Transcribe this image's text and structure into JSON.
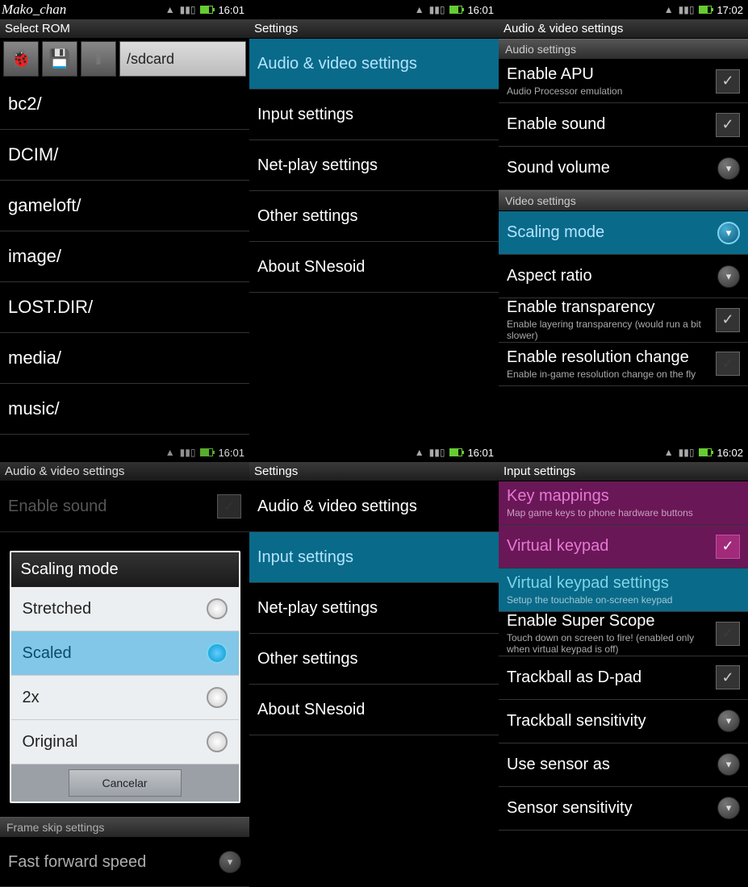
{
  "watermark": "Mako_chan",
  "panels": {
    "p1": {
      "time": "16:01",
      "title": "Select ROM",
      "path": "/sdcard",
      "items": [
        "bc2/",
        "DCIM/",
        "gameloft/",
        "image/",
        "LOST.DIR/",
        "media/",
        "music/"
      ]
    },
    "p2": {
      "time": "16:01",
      "title": "Settings",
      "items": [
        {
          "label": "Audio & video settings",
          "sel": true
        },
        {
          "label": "Input settings"
        },
        {
          "label": "Net-play settings"
        },
        {
          "label": "Other settings"
        },
        {
          "label": "About SNesoid"
        }
      ]
    },
    "p3": {
      "time": "17:02",
      "title": "Audio & video settings",
      "audioHeader": "Audio settings",
      "videoHeader": "Video settings",
      "audio": [
        {
          "label": "Enable APU",
          "sub": "Audio Processor emulation",
          "ctrl": "check",
          "on": true
        },
        {
          "label": "Enable sound",
          "ctrl": "check",
          "on": true
        },
        {
          "label": "Sound volume",
          "ctrl": "expand"
        }
      ],
      "video": [
        {
          "label": "Scaling mode",
          "ctrl": "expand",
          "sel": true
        },
        {
          "label": "Aspect ratio",
          "ctrl": "expand"
        },
        {
          "label": "Enable transparency",
          "sub": "Enable layering transparency (would run a bit slower)",
          "ctrl": "check",
          "on": true
        },
        {
          "label": "Enable resolution change",
          "sub": "Enable in-game resolution change on the fly",
          "ctrl": "check",
          "on": false
        }
      ]
    },
    "p4": {
      "time": "16:01",
      "title": "Audio & video settings",
      "bgTop": {
        "label": "Enable sound"
      },
      "frameHeader": "Frame skip settings",
      "bgBottom": {
        "label": "Fast forward speed"
      },
      "dialog": {
        "title": "Scaling mode",
        "options": [
          {
            "label": "Stretched"
          },
          {
            "label": "Scaled",
            "sel": true
          },
          {
            "label": "2x"
          },
          {
            "label": "Original"
          }
        ],
        "cancel": "Cancelar"
      }
    },
    "p5": {
      "time": "16:01",
      "title": "Settings",
      "items": [
        {
          "label": "Audio & video settings"
        },
        {
          "label": "Input settings",
          "sel": true
        },
        {
          "label": "Net-play settings"
        },
        {
          "label": "Other settings"
        },
        {
          "label": "About SNesoid"
        }
      ]
    },
    "p6": {
      "time": "16:02",
      "title": "Input settings",
      "items": [
        {
          "label": "Key mappings",
          "sub": "Map game keys to phone hardware buttons",
          "style": "pink"
        },
        {
          "label": "Virtual keypad",
          "ctrl": "check",
          "on": true,
          "style": "pink"
        },
        {
          "label": "Virtual keypad settings",
          "sub": "Setup the touchable on-screen keypad",
          "style": "teal"
        },
        {
          "label": "Enable Super Scope",
          "sub": "Touch down on screen to fire! (enabled only when virtual keypad is off)",
          "ctrl": "check",
          "on": false
        },
        {
          "label": "Trackball as D-pad",
          "ctrl": "check",
          "on": true
        },
        {
          "label": "Trackball sensitivity",
          "ctrl": "expand"
        },
        {
          "label": "Use sensor as",
          "ctrl": "expand"
        },
        {
          "label": "Sensor sensitivity",
          "ctrl": "expand"
        }
      ]
    }
  }
}
